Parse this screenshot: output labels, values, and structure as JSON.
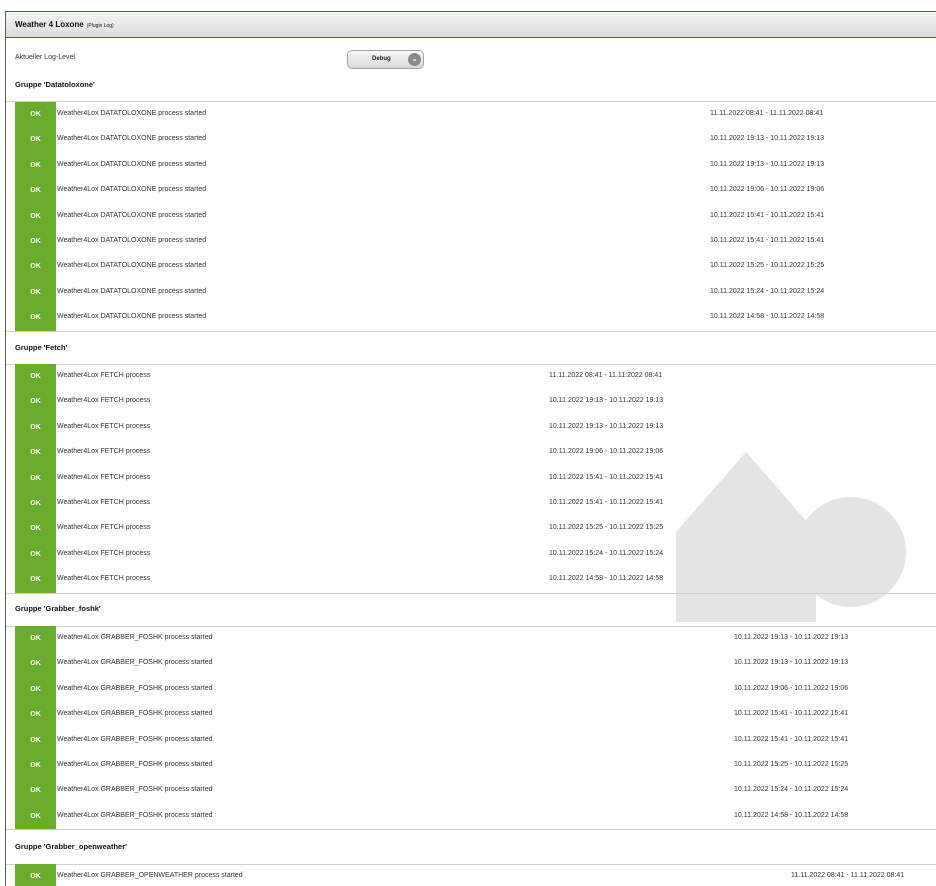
{
  "panel": {
    "title": "Weather 4 Loxone",
    "subtitle": "(Plugin Log)"
  },
  "loglevel": {
    "label": "Aktueller Log-Level",
    "value": "Debug"
  },
  "icons": {
    "select": "chevron-down-icon",
    "watermark": "loxberry-house-logo"
  },
  "colors": {
    "ok": "#6aac2b",
    "border": "#4f6b3a"
  },
  "groups": [
    {
      "title": "Gruppe 'Datatoloxone'",
      "rows": [
        {
          "status": "OK",
          "message": "Weather4Lox DATATOLOXONE process started",
          "date": "11.11.2022 08:41 - 11.11.2022 08:41"
        },
        {
          "status": "OK",
          "message": "Weather4Lox DATATOLOXONE process started",
          "date": "10.11.2022 19:13 - 10.11.2022 19:13"
        },
        {
          "status": "OK",
          "message": "Weather4Lox DATATOLOXONE process started",
          "date": "10.11.2022 19:13 - 10.11.2022 19:13"
        },
        {
          "status": "OK",
          "message": "Weather4Lox DATATOLOXONE process started",
          "date": "10.11.2022 19:06 - 10.11.2022 19:06"
        },
        {
          "status": "OK",
          "message": "Weather4Lox DATATOLOXONE process started",
          "date": "10.11.2022 15:41 - 10.11.2022 15:41"
        },
        {
          "status": "OK",
          "message": "Weather4Lox DATATOLOXONE process started",
          "date": "10.11.2022 15:41 - 10.11.2022 15:41"
        },
        {
          "status": "OK",
          "message": "Weather4Lox DATATOLOXONE process started",
          "date": "10.11.2022 15:25 - 10.11.2022 15:25"
        },
        {
          "status": "OK",
          "message": "Weather4Lox DATATOLOXONE process started",
          "date": "10.11.2022 15:24 - 10.11.2022 15:24"
        },
        {
          "status": "OK",
          "message": "Weather4Lox DATATOLOXONE process started",
          "date": "10.11.2022 14:58 - 10.11.2022 14:58"
        }
      ]
    },
    {
      "title": "Gruppe 'Fetch'",
      "rows": [
        {
          "status": "OK",
          "message": "Weather4Lox FETCH process",
          "date": "11.11.2022 08:41 - 11.11.2022 08:41"
        },
        {
          "status": "OK",
          "message": "Weather4Lox FETCH process",
          "date": "10.11.2022 19:13 - 10.11.2022 19:13"
        },
        {
          "status": "OK",
          "message": "Weather4Lox FETCH process",
          "date": "10.11.2022 19:13 - 10.11.2022 19:13"
        },
        {
          "status": "OK",
          "message": "Weather4Lox FETCH process",
          "date": "10.11.2022 19:06 - 10.11.2022 19:06"
        },
        {
          "status": "OK",
          "message": "Weather4Lox FETCH process",
          "date": "10.11.2022 15:41 - 10.11.2022 15:41"
        },
        {
          "status": "OK",
          "message": "Weather4Lox FETCH process",
          "date": "10.11.2022 15:41 - 10.11.2022 15:41"
        },
        {
          "status": "OK",
          "message": "Weather4Lox FETCH process",
          "date": "10.11.2022 15:25 - 10.11.2022 15:25"
        },
        {
          "status": "OK",
          "message": "Weather4Lox FETCH process",
          "date": "10.11.2022 15:24 - 10.11.2022 15:24"
        },
        {
          "status": "OK",
          "message": "Weather4Lox FETCH process",
          "date": "10.11.2022 14:58 - 10.11.2022 14:58"
        }
      ]
    },
    {
      "title": "Gruppe 'Grabber_foshk'",
      "rows": [
        {
          "status": "OK",
          "message": "Weather4Lox GRABBER_FOSHK process started",
          "date": "10.11.2022 19:13 - 10.11.2022 19:13"
        },
        {
          "status": "OK",
          "message": "Weather4Lox GRABBER_FOSHK process started",
          "date": "10.11.2022 19:13 - 10.11.2022 19:13"
        },
        {
          "status": "OK",
          "message": "Weather4Lox GRABBER_FOSHK process started",
          "date": "10.11.2022 19:06 - 10.11.2022 19:06"
        },
        {
          "status": "OK",
          "message": "Weather4Lox GRABBER_FOSHK process started",
          "date": "10.11.2022 15:41 - 10.11.2022 15:41"
        },
        {
          "status": "OK",
          "message": "Weather4Lox GRABBER_FOSHK process started",
          "date": "10.11.2022 15:41 - 10.11.2022 15:41"
        },
        {
          "status": "OK",
          "message": "Weather4Lox GRABBER_FOSHK process started",
          "date": "10.11.2022 15:25 - 10.11.2022 15:25"
        },
        {
          "status": "OK",
          "message": "Weather4Lox GRABBER_FOSHK process started",
          "date": "10.11.2022 15:24 - 10.11.2022 15:24"
        },
        {
          "status": "OK",
          "message": "Weather4Lox GRABBER_FOSHK process started",
          "date": "10.11.2022 14:58 - 10.11.2022 14:58"
        }
      ]
    },
    {
      "title": "Gruppe 'Grabber_openweather'",
      "rows": [
        {
          "status": "OK",
          "message": "Weather4Lox GRABBER_OPENWEATHER process started",
          "date": "11.11.2022 08:41 - 11.11.2022 08:41"
        }
      ]
    }
  ]
}
